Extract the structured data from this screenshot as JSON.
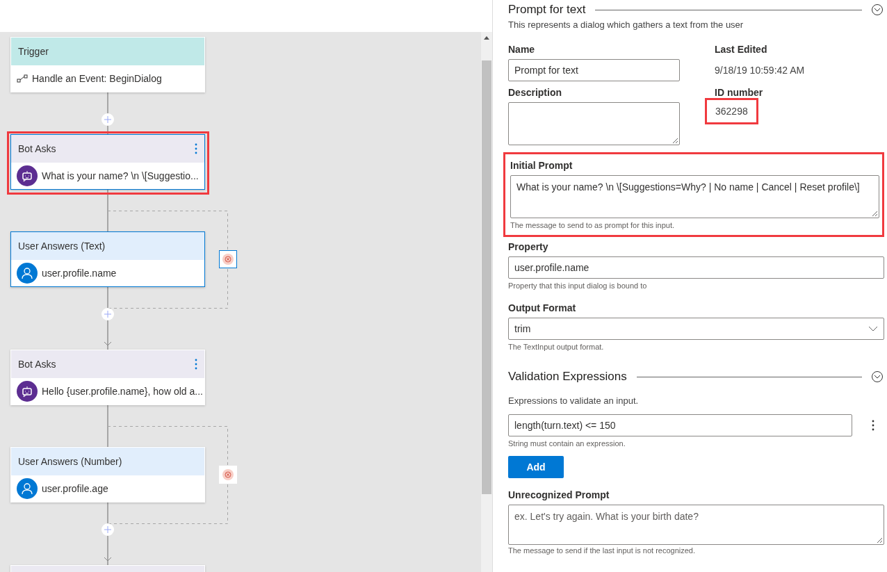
{
  "canvas": {
    "nodes": [
      {
        "kind": "trigger",
        "title": "Trigger",
        "text": "Handle an Event: BeginDialog",
        "selected": false,
        "highlighted": false
      },
      {
        "kind": "bot",
        "title": "Bot Asks",
        "text": "What is your name? \\n \\[Suggestio...",
        "selected": true,
        "highlighted": true
      },
      {
        "kind": "user",
        "title": "User Answers (Text)",
        "text": "user.profile.name",
        "selected": true,
        "highlighted": false
      },
      {
        "kind": "bot",
        "title": "Bot Asks",
        "text": "Hello {user.profile.name}, how old a...",
        "selected": false,
        "highlighted": false
      },
      {
        "kind": "user",
        "title": "User Answers (Number)",
        "text": "user.profile.age",
        "selected": false,
        "highlighted": false
      }
    ]
  },
  "properties": {
    "title": "Prompt for text",
    "expanded": true,
    "description": "This represents a dialog which gathers a text from the user",
    "name": {
      "label": "Name",
      "value": "Prompt for text"
    },
    "description_field": {
      "label": "Description"
    },
    "last_edited": {
      "label": "Last Edited",
      "value": "9/18/19 10:59:42 AM"
    },
    "id_number": {
      "label": "ID number",
      "value": "362298",
      "highlighted": true
    },
    "initial_prompt": {
      "label": "Initial Prompt",
      "value": "What is your name? \\n \\[Suggestions=Why? | No name | Cancel | Reset profile\\]",
      "hint": "The message to send to as prompt for this input.",
      "highlighted": true
    },
    "property": {
      "label": "Property",
      "value": "user.profile.name",
      "hint": "Property that this input dialog is bound to"
    },
    "output_format": {
      "label": "Output Format",
      "value": "trim",
      "hint": "The TextInput output format."
    }
  },
  "validation": {
    "title": "Validation Expressions",
    "expanded": true,
    "description": "Expressions to validate an input.",
    "expressions": [
      {
        "value": "length(turn.text) <= 150",
        "hint": "String must contain an expression."
      }
    ],
    "add_button": "Add",
    "unrecognized_prompt": {
      "label": "Unrecognized Prompt",
      "placeholder": "ex. Let's try again. What is your birth date?",
      "hint": "The message to send if the last input is not recognized."
    }
  }
}
